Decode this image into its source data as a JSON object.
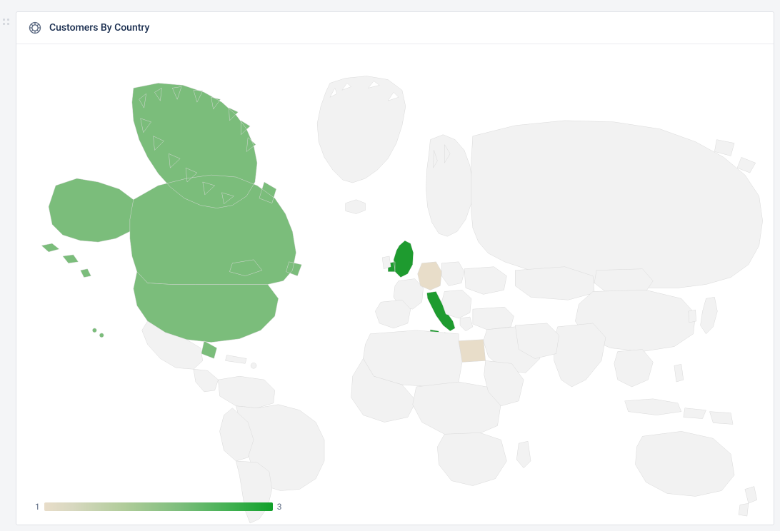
{
  "panel": {
    "title": "Customers By Country"
  },
  "legend": {
    "min": "1",
    "max": "3"
  },
  "chart_data": {
    "type": "choropleth",
    "metric": "Customers",
    "color_scale": {
      "min_color": "#e8ddc9",
      "max_color": "#11a02a",
      "min_value": 1,
      "max_value": 3
    },
    "countries": [
      {
        "name": "Canada",
        "value": 2
      },
      {
        "name": "United States",
        "value": 2
      },
      {
        "name": "United Kingdom",
        "value": 3
      },
      {
        "name": "Italy",
        "value": 3
      },
      {
        "name": "Germany",
        "value": 1
      },
      {
        "name": "Egypt",
        "value": 1
      }
    ]
  }
}
